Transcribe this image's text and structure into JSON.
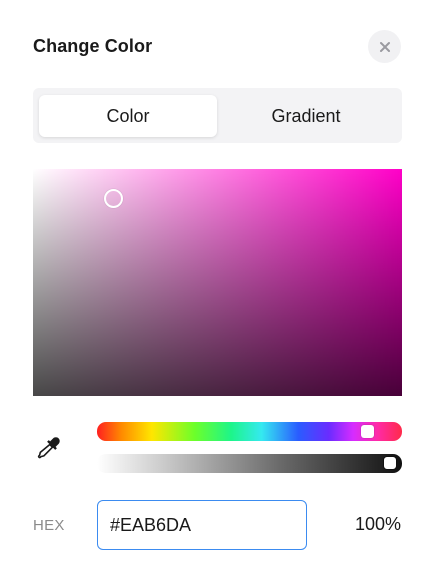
{
  "dialog": {
    "title": "Change Color",
    "close_icon": "close-icon"
  },
  "tabs": [
    {
      "label": "Color",
      "active": true
    },
    {
      "label": "Gradient",
      "active": false
    }
  ],
  "picker": {
    "hue_base_color": "#ff00c8"
  },
  "eyedropper": {
    "icon": "eyedropper-icon"
  },
  "hex": {
    "label": "HEX",
    "value": "#EAB6DA"
  },
  "opacity": {
    "value": "100%"
  }
}
